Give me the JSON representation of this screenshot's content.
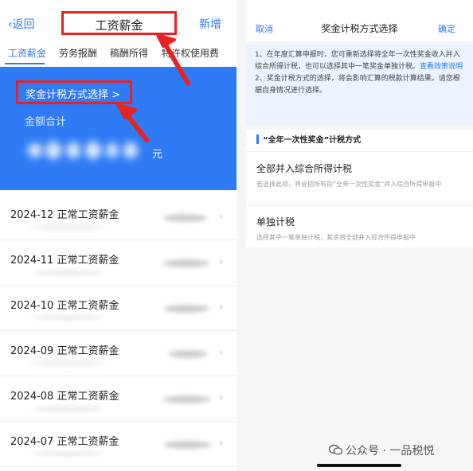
{
  "left": {
    "nav": {
      "back_label": "返回",
      "title": "工资薪金",
      "add_label": "新增"
    },
    "tabs": [
      {
        "label": "工资薪金",
        "active": true
      },
      {
        "label": "劳务报酬",
        "active": false
      },
      {
        "label": "稿酬所得",
        "active": false
      },
      {
        "label": "特许权使用费",
        "active": false
      }
    ],
    "banner": {
      "method_label": "奖金计税方式选择 >",
      "amount_label": "金额合计",
      "amount_currency": "元"
    },
    "records": [
      {
        "label": "2024-12 正常工资薪金"
      },
      {
        "label": "2024-11 正常工资薪金"
      },
      {
        "label": "2024-10 正常工资薪金"
      },
      {
        "label": "2024-09 正常工资薪金"
      },
      {
        "label": "2024-08 正常工资薪金"
      },
      {
        "label": "2024-07 正常工资薪金"
      }
    ]
  },
  "right": {
    "nav": {
      "cancel_label": "取消",
      "title": "奖金计税方式选择",
      "confirm_label": "确定"
    },
    "notice": {
      "line1": "1、在年度汇算申报时，您可重新选择将全年一次性奖金收入并入综合所得计税，也可以选择其中一笔奖金单独计税。",
      "line1_link": "查看政策说明",
      "line2": "2、奖金计税方式的选择，将会影响汇算的税款计算结果。请您根据自身情况进行选择。"
    },
    "section_title": "“全年一次性奖金”计税方式",
    "options": [
      {
        "title": "全部并入综合所得计税",
        "desc": "若选择此项，将会把所有的“全年一次性奖金”并入综合所得申报中"
      },
      {
        "title": "单独计税",
        "desc": "选择其中一笔单独计税，其余将全部并入综合所得申报中"
      }
    ],
    "watermark": "公众号 · 一品税悦"
  },
  "colors": {
    "accent": "#2f7bf5",
    "highlight_red": "#e52323",
    "banner_blue": "#2f7bf5",
    "notice_bg": "#eaf3ff"
  },
  "icons": [
    "chevron-left-icon",
    "chevron-right-icon",
    "wechat-icon"
  ]
}
